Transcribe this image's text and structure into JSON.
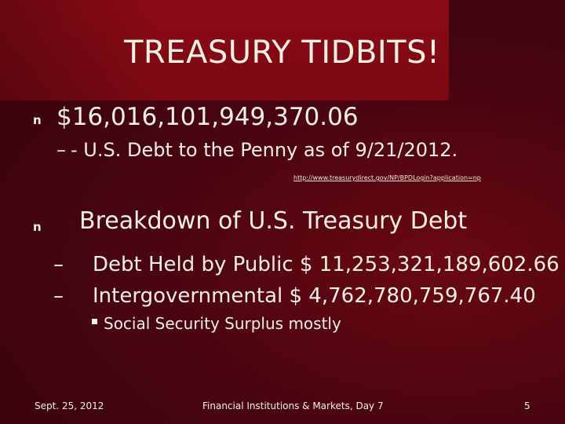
{
  "title": "TREASURY TIDBITS!",
  "bullets": {
    "marker": "n",
    "sub_marker": "–",
    "debt_total": "$16,016,101,949,370.06",
    "debt_total_subline_prefix": "- ",
    "debt_total_subline": "U.S. Debt to the Penny as of  9/21/2012.",
    "source_url": "http://www.treasurydirect.gov/NP/BPDLogin?application=np",
    "breakdown_heading": "Breakdown of U.S. Treasury Debt",
    "details": [
      {
        "text": "Debt Held by Public  $ 11,253,321,189,602.66"
      },
      {
        "text": "Intergovernmental  $ 4,762,780,759,767.40"
      }
    ],
    "sub_detail": "Social Security Surplus mostly"
  },
  "footer": {
    "date": "Sept. 25, 2012",
    "course": "Financial Institutions & Markets, Day 7",
    "page_number": "5"
  },
  "colors": {
    "background": "#4a0510",
    "title_band": "#8c0a16",
    "text": "#f2f0e4"
  },
  "icons": {
    "bullet": "square-bullet-icon",
    "sub_bullet": "small-square-bullet-icon"
  }
}
